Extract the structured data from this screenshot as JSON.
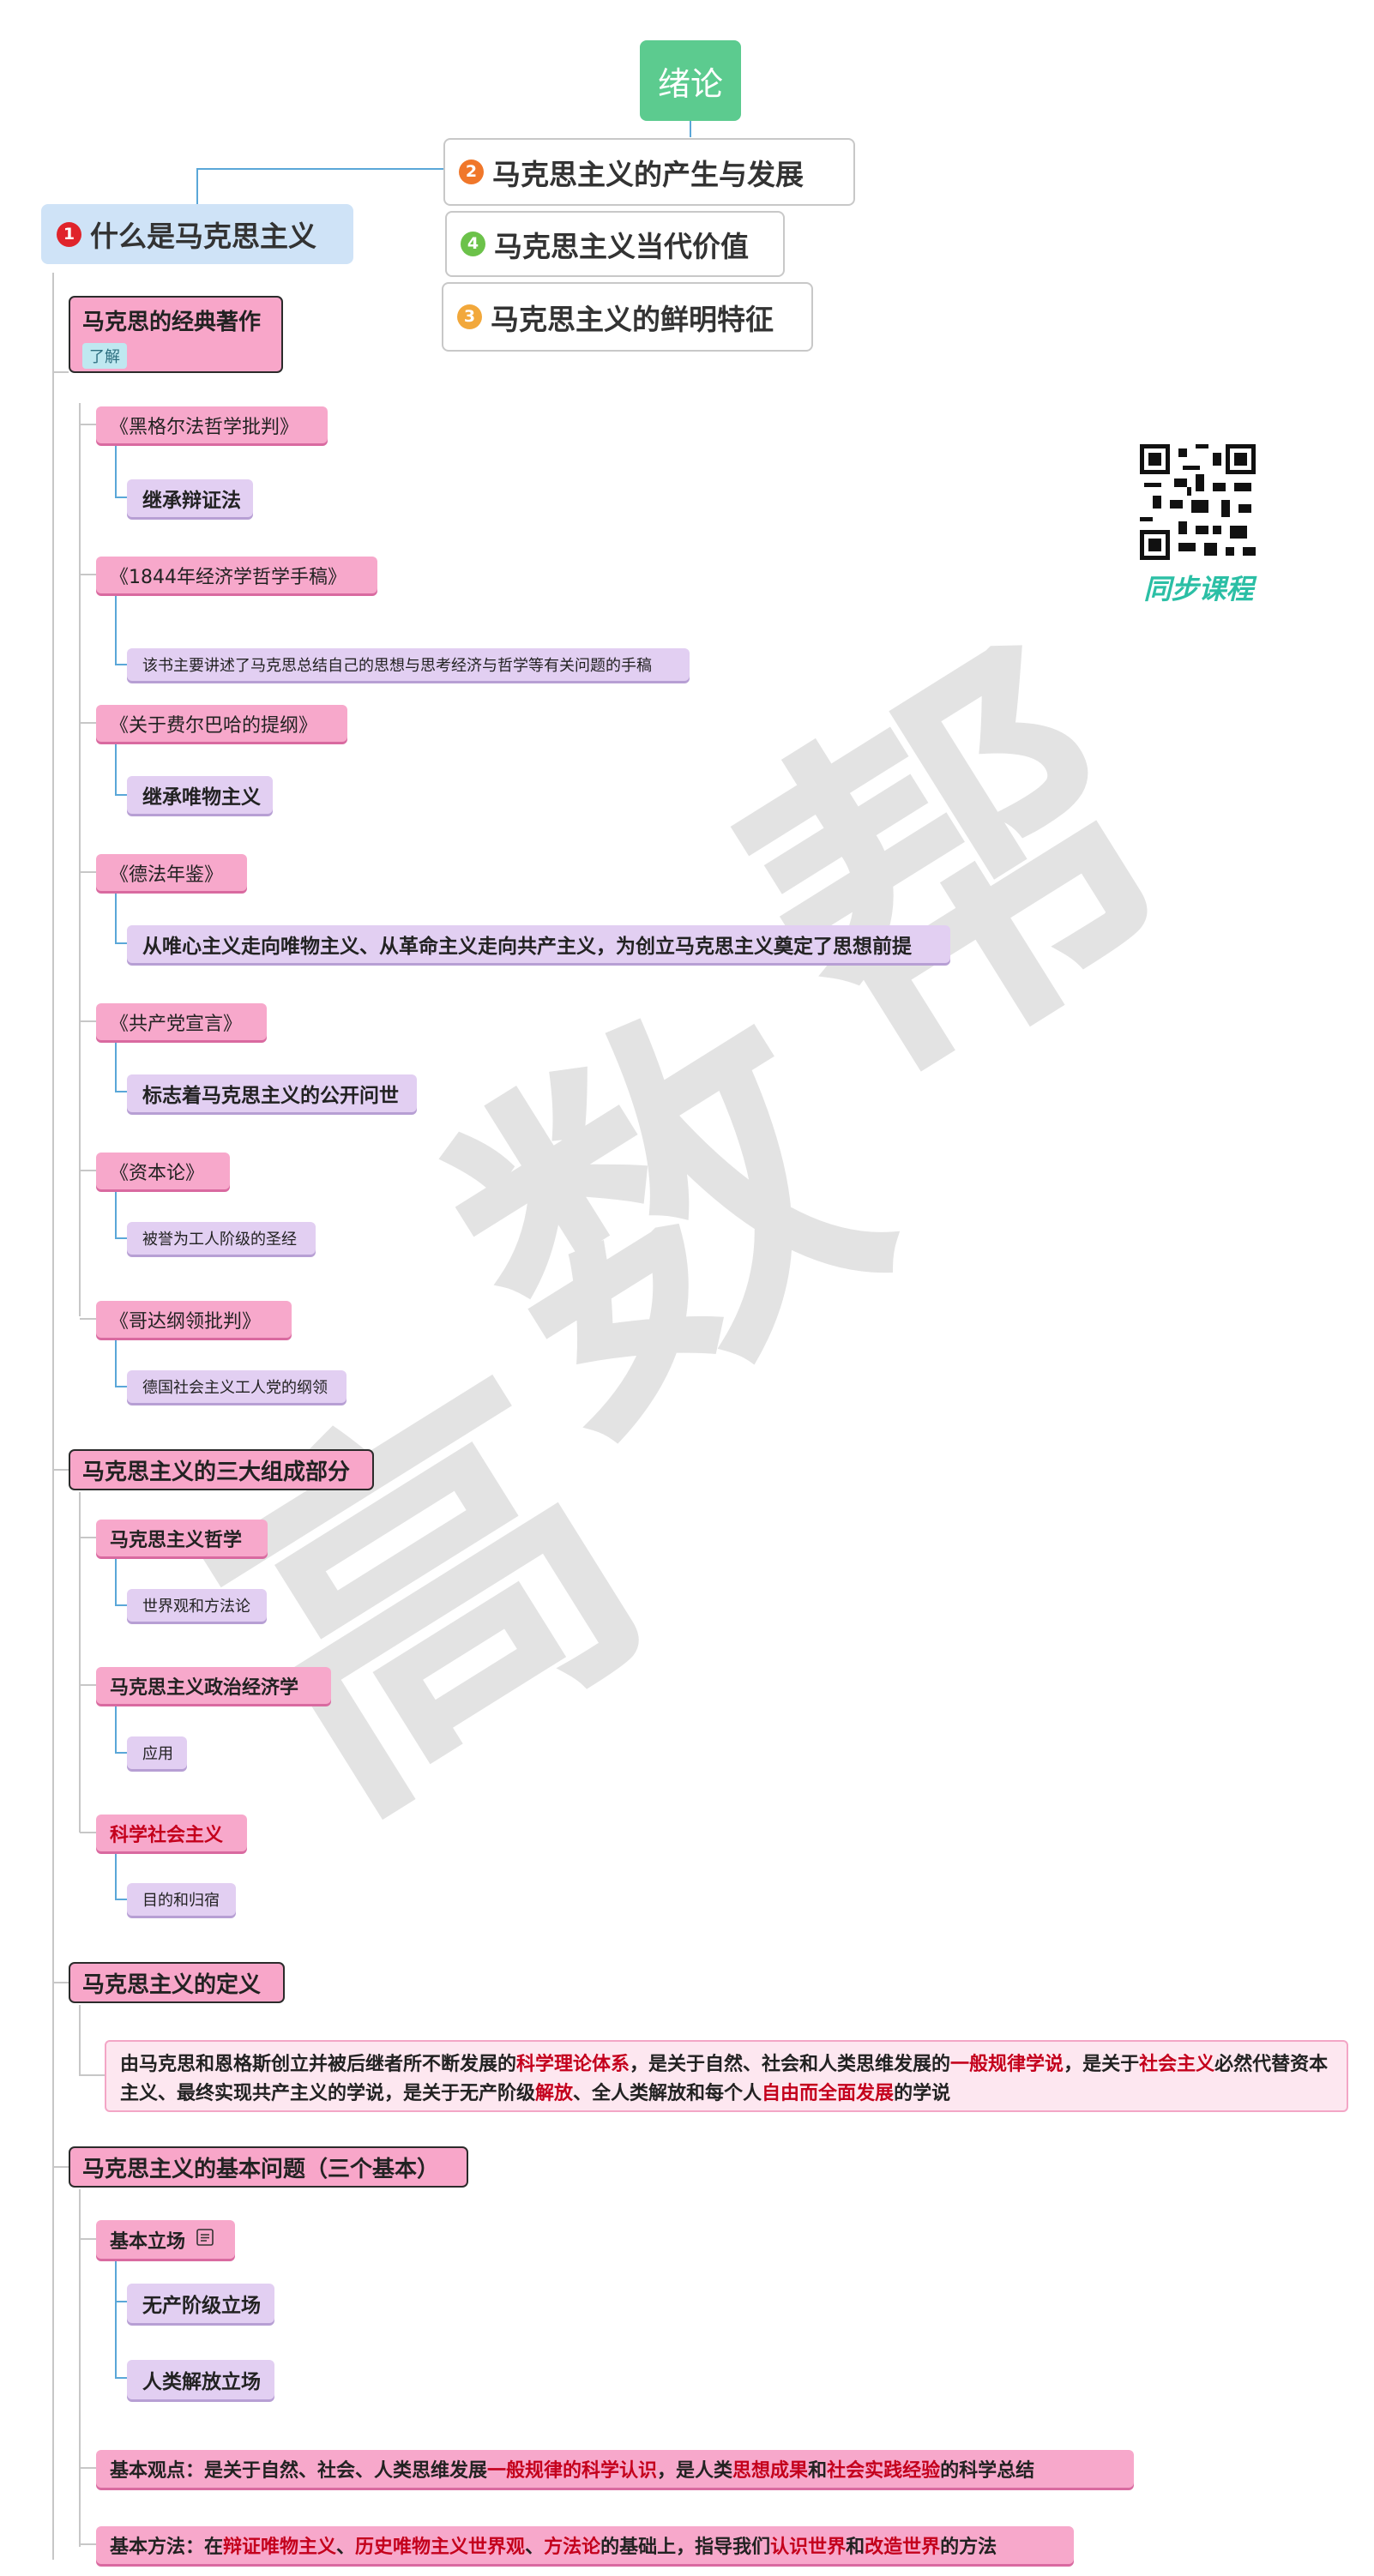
{
  "root": {
    "label": "绪论"
  },
  "level1": [
    {
      "num": "1",
      "label": "什么是马克思主义",
      "num_color": "#e0242b"
    },
    {
      "num": "2",
      "label": "马克思主义的产生与发展",
      "num_color": "#f0772a"
    },
    {
      "num": "4",
      "label": "马克思主义当代价值",
      "num_color": "#6cc24a"
    },
    {
      "num": "3",
      "label": "马克思主义的鲜明特征",
      "num_color": "#f2a83b"
    }
  ],
  "qr": {
    "caption": "同步课程"
  },
  "watermark": {
    "chars": [
      "高",
      "数",
      "帮"
    ]
  },
  "sections": [
    {
      "label": "马克思的经典著作",
      "tag": "了解",
      "items": [
        {
          "title": "《黑格尔法哲学批判》",
          "desc": "继承辩证法"
        },
        {
          "title": "《1844年经济学哲学手稿》",
          "desc": "该书主要讲述了马克思总结自己的思想与思考经济与哲学等有关问题的手稿"
        },
        {
          "title": "《关于费尔巴哈的提纲》",
          "desc": "继承唯物主义"
        },
        {
          "title": "《德法年鉴》",
          "desc": "从唯心主义走向唯物主义、从革命主义走向共产主义，为创立马克思主义奠定了思想前提"
        },
        {
          "title": "《共产党宣言》",
          "desc": "标志着马克思主义的公开问世"
        },
        {
          "title": "《资本论》",
          "desc": "被誉为工人阶级的圣经"
        },
        {
          "title": "《哥达纲领批判》",
          "desc": "德国社会主义工人党的纲领"
        }
      ]
    },
    {
      "label": "马克思主义的三大组成部分",
      "items": [
        {
          "title": "马克思主义哲学",
          "desc": "世界观和方法论"
        },
        {
          "title": "马克思主义政治经济学",
          "desc": "应用"
        },
        {
          "title": "科学社会主义",
          "desc": "目的和归宿"
        }
      ]
    },
    {
      "label": "马克思主义的定义",
      "definition": [
        {
          "t": "由马克思和恩格斯创立并被后继者所不断发展的",
          "hl": false
        },
        {
          "t": "科学理论体系",
          "hl": true
        },
        {
          "t": "，是关于自然、社会和人类思维发展的",
          "hl": false
        },
        {
          "t": "一般规律学说",
          "hl": true
        },
        {
          "t": "，是关于",
          "hl": false
        },
        {
          "t": "社会主义",
          "hl": true
        },
        {
          "t": "必然代替资本主义、最终实现共产主义的学说，是关于无产阶级",
          "hl": false
        },
        {
          "t": "解放",
          "hl": true
        },
        {
          "t": "、全人类解放和每个人",
          "hl": false
        },
        {
          "t": "自由而全面发展",
          "hl": true
        },
        {
          "t": "的学说",
          "hl": false
        }
      ]
    },
    {
      "label": "马克思主义的基本问题（三个基本）",
      "stance": {
        "title": "基本立场",
        "items": [
          "无产阶级立场",
          "人类解放立场"
        ]
      },
      "viewpoint": [
        {
          "t": "基本观点：是关于自然、社会、人类思维发展",
          "hl": false
        },
        {
          "t": "一般规律的科学认识",
          "hl": true
        },
        {
          "t": "，是人类",
          "hl": false
        },
        {
          "t": "思想成果",
          "hl": true
        },
        {
          "t": "和",
          "hl": false
        },
        {
          "t": "社会实践经验",
          "hl": true
        },
        {
          "t": "的科学总结",
          "hl": false
        }
      ],
      "method": [
        {
          "t": "基本方法：在",
          "hl": false
        },
        {
          "t": "辩证唯物主义",
          "hl": true
        },
        {
          "t": "、",
          "hl": false
        },
        {
          "t": "历史唯物主义世界观",
          "hl": true
        },
        {
          "t": "、",
          "hl": false
        },
        {
          "t": "方法论",
          "hl": true
        },
        {
          "t": "的基础上，指导我们",
          "hl": false
        },
        {
          "t": "认识世界",
          "hl": true
        },
        {
          "t": "和",
          "hl": false
        },
        {
          "t": "改造世界",
          "hl": true
        },
        {
          "t": "的方法",
          "hl": false
        }
      ]
    }
  ],
  "colors": {
    "root": "#5ccb8f",
    "section_fill": "#f8a6c9",
    "item_fill": "#f7a8cb",
    "desc_fill": "#e2cff2",
    "highlight": "#c4001c",
    "connector": "#5aa7d8",
    "qr_caption": "#2bbfa5"
  }
}
